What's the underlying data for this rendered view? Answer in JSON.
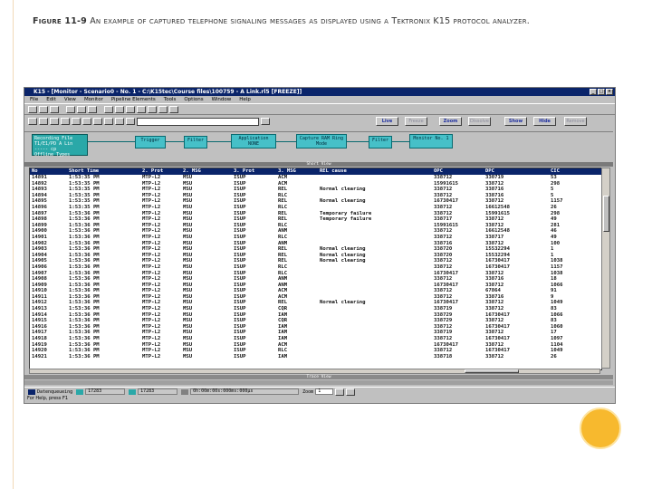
{
  "caption": {
    "label": "Figure 11-9",
    "text": " An example of captured telephone signaling messages as displayed using a Tektronix K15 protocol analyzer."
  },
  "window": {
    "title": "K15 - [Monitor - Scenario0 - No. 1 - C:\\K15tec\\Course files\\100759 - A Link.rl5 [FREEZE]]",
    "menus": [
      "File",
      "Edit",
      "View",
      "Monitor",
      "Pipeline Elements",
      "Tools",
      "Options",
      "Window",
      "Help"
    ]
  },
  "toolbar_buttons": [
    "Live",
    "Freeze",
    "Zoom",
    "Dissolve",
    "Show",
    "Hide",
    "Remove"
  ],
  "pipeline": {
    "recording": [
      "Recording File",
      "T1/E1/PD  A Lin",
      "----- cp",
      "Offline   Types"
    ],
    "nodes": [
      "Trigger",
      "Filter",
      "Application NONE",
      "Capture RAM Ring Mode",
      "Filter",
      "Monitor No. 1"
    ]
  },
  "panes": {
    "short_view": "Short View",
    "trace_view": "Trace View"
  },
  "table": {
    "columns": [
      "No",
      "Short Time",
      "2. Prot",
      "2. MSG",
      "3. Prot",
      "3. MSG",
      "REL cause",
      "OPC",
      "DPC",
      "CIC"
    ],
    "rows": [
      [
        "14891",
        "1:53:35 PM",
        "MTP-L2",
        "MSU",
        "ISUP",
        "ACM",
        "",
        "338712",
        "330719",
        "53"
      ],
      [
        "14892",
        "1:53:35 PM",
        "MTP-L2",
        "MSU",
        "ISUP",
        "ACM",
        "",
        "15991615",
        "338712",
        "298"
      ],
      [
        "14893",
        "1:53:35 PM",
        "MTP-L2",
        "MSU",
        "ISUP",
        "REL",
        "Normal clearing",
        "338712",
        "338716",
        "5"
      ],
      [
        "14894",
        "1:53:35 PM",
        "MTP-L2",
        "MSU",
        "ISUP",
        "RLC",
        "",
        "338712",
        "338716",
        "5"
      ],
      [
        "14895",
        "1:53:35 PM",
        "MTP-L2",
        "MSU",
        "ISUP",
        "REL",
        "Normal clearing",
        "16730417",
        "338712",
        "1157"
      ],
      [
        "14896",
        "1:53:35 PM",
        "MTP-L2",
        "MSU",
        "ISUP",
        "RLC",
        "",
        "338712",
        "16612548",
        "26"
      ],
      [
        "14897",
        "1:53:36 PM",
        "MTP-L2",
        "MSU",
        "ISUP",
        "REL",
        "Temporary failure",
        "338712",
        "15991615",
        "298"
      ],
      [
        "14898",
        "1:53:36 PM",
        "MTP-L2",
        "MSU",
        "ISUP",
        "REL",
        "Temporary failure",
        "338717",
        "338712",
        "49"
      ],
      [
        "14899",
        "1:53:36 PM",
        "MTP-L2",
        "MSU",
        "ISUP",
        "RLC",
        "",
        "15991615",
        "338712",
        "281"
      ],
      [
        "14900",
        "1:53:36 PM",
        "MTP-L2",
        "MSU",
        "ISUP",
        "ANM",
        "",
        "338712",
        "16612548",
        "46"
      ],
      [
        "14901",
        "1:53:36 PM",
        "MTP-L2",
        "MSU",
        "ISUP",
        "RLC",
        "",
        "338712",
        "338717",
        "49"
      ],
      [
        "14902",
        "1:53:36 PM",
        "MTP-L2",
        "MSU",
        "ISUP",
        "ANM",
        "",
        "338716",
        "338712",
        "100"
      ],
      [
        "14903",
        "1:53:36 PM",
        "MTP-L2",
        "MSU",
        "ISUP",
        "REL",
        "Normal clearing",
        "338720",
        "15532294",
        "1"
      ],
      [
        "14904",
        "1:53:36 PM",
        "MTP-L2",
        "MSU",
        "ISUP",
        "REL",
        "Normal clearing",
        "338720",
        "15532294",
        "1"
      ],
      [
        "14905",
        "1:53:36 PM",
        "MTP-L2",
        "MSU",
        "ISUP",
        "REL",
        "Normal clearing",
        "338712",
        "16730417",
        "1038"
      ],
      [
        "14906",
        "1:53:36 PM",
        "MTP-L2",
        "MSU",
        "ISUP",
        "RLC",
        "",
        "338712",
        "16730417",
        "1157"
      ],
      [
        "14907",
        "1:53:36 PM",
        "MTP-L2",
        "MSU",
        "ISUP",
        "RLC",
        "",
        "16730417",
        "338712",
        "1038"
      ],
      [
        "14908",
        "1:53:36 PM",
        "MTP-L2",
        "MSU",
        "ISUP",
        "ANM",
        "",
        "338712",
        "338716",
        "18"
      ],
      [
        "14909",
        "1:53:36 PM",
        "MTP-L2",
        "MSU",
        "ISUP",
        "ANM",
        "",
        "16730417",
        "338712",
        "1066"
      ],
      [
        "14910",
        "1:53:36 PM",
        "MTP-L2",
        "MSU",
        "ISUP",
        "ACM",
        "",
        "338712",
        "67864",
        "91"
      ],
      [
        "14911",
        "1:53:36 PM",
        "MTP-L2",
        "MSU",
        "ISUP",
        "ACM",
        "",
        "338712",
        "338716",
        "9"
      ],
      [
        "14912",
        "1:53:36 PM",
        "MTP-L2",
        "MSU",
        "ISUP",
        "REL",
        "Normal clearing",
        "16730417",
        "338712",
        "1049"
      ],
      [
        "14913",
        "1:53:36 PM",
        "MTP-L2",
        "MSU",
        "ISUP",
        "CQR",
        "",
        "338719",
        "338712",
        "83"
      ],
      [
        "14914",
        "1:53:36 PM",
        "MTP-L2",
        "MSU",
        "ISUP",
        "IAM",
        "",
        "338729",
        "16730417",
        "1066"
      ],
      [
        "14915",
        "1:53:36 PM",
        "MTP-L2",
        "MSU",
        "ISUP",
        "CQR",
        "",
        "338729",
        "338712",
        "83"
      ],
      [
        "14916",
        "1:53:36 PM",
        "MTP-L2",
        "MSU",
        "ISUP",
        "IAM",
        "",
        "338712",
        "16730417",
        "1060"
      ],
      [
        "14917",
        "1:53:36 PM",
        "MTP-L2",
        "MSU",
        "ISUP",
        "IAM",
        "",
        "338719",
        "338712",
        "17"
      ],
      [
        "14918",
        "1:53:36 PM",
        "MTP-L2",
        "MSU",
        "ISUP",
        "IAM",
        "",
        "338712",
        "16730417",
        "1097"
      ],
      [
        "14919",
        "1:53:36 PM",
        "MTP-L2",
        "MSU",
        "ISUP",
        "ACM",
        "",
        "16730417",
        "338712",
        "1104"
      ],
      [
        "14920",
        "1:53:36 PM",
        "MTP-L2",
        "MSU",
        "ISUP",
        "RLC",
        "",
        "338712",
        "16730417",
        "1049"
      ],
      [
        "14921",
        "1:53:36 PM",
        "MTP-L2",
        "MSU",
        "ISUP",
        "IAM",
        "",
        "338718",
        "338712",
        "26"
      ]
    ]
  },
  "bottom": {
    "queue": "Datenqueueing",
    "count1": "17283",
    "count2": "17283",
    "elapsed": "0h:00m:00s:000ms:000µs",
    "zoom": "Zoom",
    "zoom_value": "1"
  },
  "statusbar": "For Help, press F1"
}
